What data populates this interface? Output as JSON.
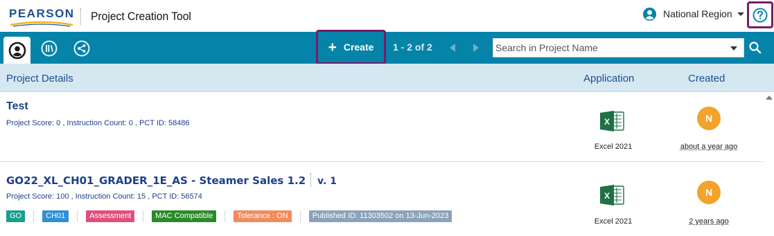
{
  "header": {
    "logo_text": "PEARSON",
    "app_title": "Project Creation Tool",
    "region_label": "National Region",
    "help_icon": "help-circle-icon"
  },
  "toolbar": {
    "tabs": [
      {
        "icon": "user-icon",
        "active": true
      },
      {
        "icon": "library-icon",
        "active": false
      },
      {
        "icon": "share-icon",
        "active": false
      }
    ],
    "create_label": "Create",
    "pager_text": "1 - 2 of 2",
    "search_placeholder": "Search in Project Name",
    "search_value": ""
  },
  "columns": {
    "details": "Project Details",
    "application": "Application",
    "created": "Created"
  },
  "rows": [
    {
      "title": "Test",
      "version": "",
      "meta": "Project Score: 0 , Instruction Count: 0 , PCT ID: 58486",
      "tags": [],
      "app_label": "Excel 2021",
      "avatar_initial": "N",
      "created": "about a year ago"
    },
    {
      "title": "GO22_XL_CH01_GRADER_1E_AS - Steamer Sales 1.2",
      "version": "v. 1",
      "meta": "Project Score: 100 , Instruction Count: 15 , PCT ID: 56574",
      "tags": [
        {
          "label": "GO",
          "color": "#1a9e8f"
        },
        {
          "label": "CH01",
          "color": "#2f8fd6"
        },
        {
          "label": "Assessment",
          "color": "#e04f7c"
        },
        {
          "label": "MAC Compatible",
          "color": "#2a8a2a"
        },
        {
          "label": "Tolerance : ON",
          "color": "#f28b5c"
        },
        {
          "label": "Published ID: 11303502 on 13-Jun-2023",
          "color": "#8aa3b8"
        }
      ],
      "app_label": "Excel 2021",
      "avatar_initial": "N",
      "created": "2 years ago"
    }
  ],
  "colors": {
    "toolbar_bg": "#0583a9",
    "highlight_border": "#7a1a66",
    "header_row_bg": "#d5e7f1",
    "title_blue": "#1d3f8a",
    "avatar_orange": "#f1a32c",
    "excel_green": "#1e7145"
  }
}
